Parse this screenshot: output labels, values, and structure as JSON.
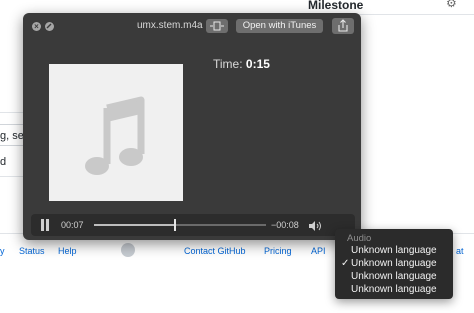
{
  "background_page": {
    "milestone_label": "Milestone",
    "gear_icon": "gear-icon",
    "input_fragment": "g, sele",
    "side_fragment": "d",
    "footer_links": [
      "y",
      "Status",
      "Help",
      "Contact GitHub",
      "Pricing",
      "API"
    ],
    "footer_tail": "at"
  },
  "quicklook": {
    "close_icon": "close-icon",
    "fullscreen_icon": "fullscreen-icon",
    "filename": "umx.stem.m4a",
    "fit_icon": "fit-to-window-icon",
    "open_button_label": "Open with iTunes",
    "share_icon": "share-icon",
    "artwork_icon": "music-note-icon",
    "time_label": "Time:",
    "time_value": "0:15",
    "player": {
      "pause_icon": "pause-icon",
      "elapsed": "00:07",
      "remaining": "−00:08",
      "progress": 0.47,
      "volume_icon": "speaker-icon"
    }
  },
  "audio_menu": {
    "header": "Audio",
    "items": [
      {
        "label": "Unknown language",
        "checked": false
      },
      {
        "label": "Unknown language",
        "checked": true
      },
      {
        "label": "Unknown language",
        "checked": false
      },
      {
        "label": "Unknown language",
        "checked": false
      }
    ],
    "checkmark": "✓"
  },
  "colors": {
    "window_bg": "#3a3a3a",
    "button_bg": "#6e6e6e",
    "link": "#0366d6",
    "menu_bg": "#2b2b2b"
  }
}
